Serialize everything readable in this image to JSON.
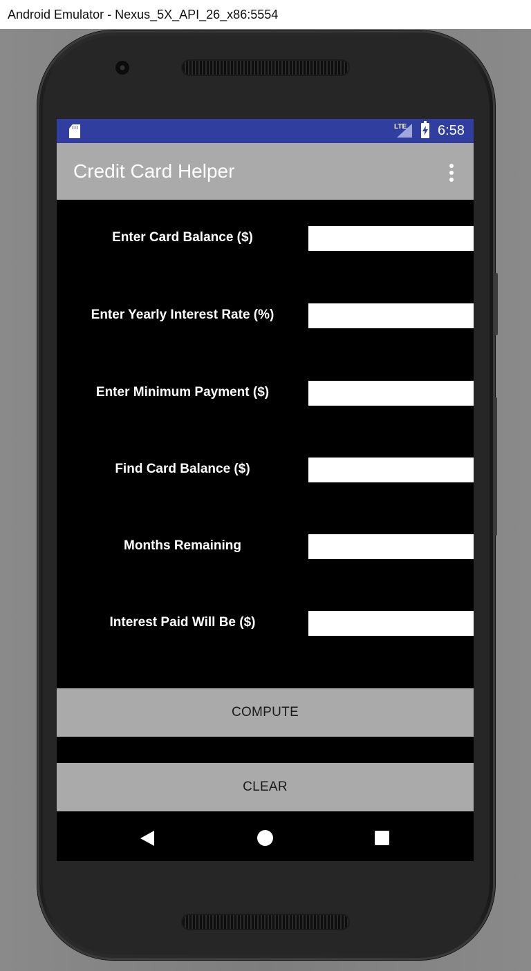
{
  "window": {
    "title": "Android Emulator - Nexus_5X_API_26_x86:5554"
  },
  "statusbar": {
    "network_label": "LTE",
    "time": "6:58",
    "icons": [
      "sd-card-icon",
      "signal-icon",
      "battery-charging-icon"
    ],
    "color": "#303f9f"
  },
  "appbar": {
    "title": "Credit Card Helper",
    "menu_icon": "overflow-menu-icon",
    "color": "#aaaaaa"
  },
  "form": {
    "fields": [
      {
        "label": "Enter Card Balance ($)",
        "value": ""
      },
      {
        "label": "Enter Yearly Interest Rate (%)",
        "value": ""
      },
      {
        "label": "Enter Minimum Payment ($)",
        "value": ""
      },
      {
        "label": "Find Card Balance ($)",
        "value": ""
      },
      {
        "label": "Months Remaining",
        "value": ""
      },
      {
        "label": "Interest Paid Will Be ($)",
        "value": ""
      }
    ]
  },
  "buttons": {
    "compute": "COMPUTE",
    "clear": "CLEAR"
  },
  "navbar": {
    "icons": [
      "back-icon",
      "home-icon",
      "recent-apps-icon"
    ]
  }
}
